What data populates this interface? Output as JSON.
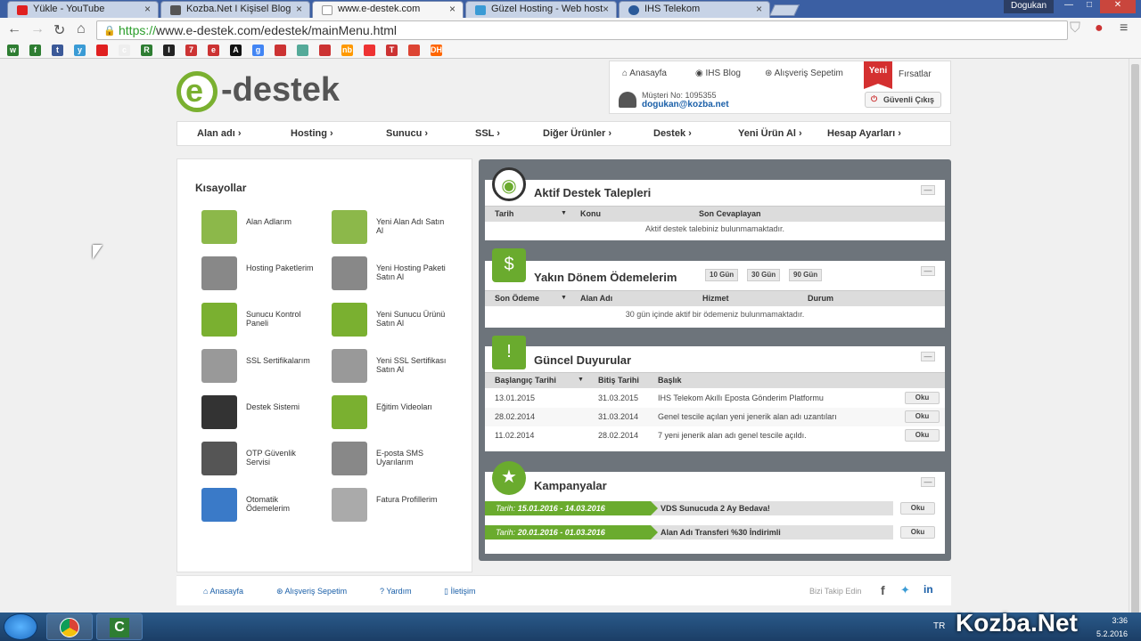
{
  "browser": {
    "tabs": [
      {
        "title": "Yükle - YouTube",
        "color": "#e02020"
      },
      {
        "title": "Kozba.Net I Kişisel Blog",
        "color": "#555555"
      },
      {
        "title": "www.e-destek.com",
        "color": "#ffffff"
      },
      {
        "title": "Güzel Hosting - Web host",
        "color": "#3a9bd5"
      },
      {
        "title": "IHS Telekom",
        "color": "#2a5a9a"
      }
    ],
    "user": "Dogukan",
    "url_scheme": "https://",
    "url_rest": "www.e-destek.com/edestek/mainMenu.html"
  },
  "bookmark_icons": [
    "w",
    "f",
    "t",
    "y",
    "",
    "c",
    "R",
    "I",
    "7",
    "e",
    "A",
    "g",
    "",
    "",
    "",
    "nb",
    "",
    "T",
    "",
    "DH"
  ],
  "logo": {
    "e": "e",
    "word": "-destek"
  },
  "header": {
    "links": [
      "Anasayfa",
      "IHS Blog",
      "Alışveriş Sepetim"
    ],
    "yeni": "Yeni",
    "firsatlar": "Fırsatlar",
    "musteri_no": "Müşteri No: 1095355",
    "email": "dogukan@kozba.net",
    "guvenli_cikis": "Güvenli Çıkış"
  },
  "menu": [
    "Alan adı",
    "Hosting",
    "Sunucu",
    "SSL",
    "Diğer Ürünler",
    "Destek",
    "Yeni Ürün Al",
    "Hesap Ayarları"
  ],
  "shortcuts": {
    "title": "Kısayollar",
    "items": [
      {
        "label": "Alan Adlarım",
        "icon": "domain-icon"
      },
      {
        "label": "Yeni Alan Adı Satın Al",
        "icon": "domain-buy-icon"
      },
      {
        "label": "Hosting Paketlerim",
        "icon": "server-icon"
      },
      {
        "label": "Yeni Hosting Paketi Satın Al",
        "icon": "server-buy-icon"
      },
      {
        "label": "Sunucu Kontrol Paneli",
        "icon": "cubes-icon"
      },
      {
        "label": "Yeni Sunucu Ürünü Satın Al",
        "icon": "cubes-buy-icon"
      },
      {
        "label": "SSL Sertifikalarım",
        "icon": "ssl-icon"
      },
      {
        "label": "Yeni SSL Sertifikası Satın Al",
        "icon": "ssl-buy-icon"
      },
      {
        "label": "Destek Sistemi",
        "icon": "headset-icon"
      },
      {
        "label": "Eğitim Videoları",
        "icon": "video-icon"
      },
      {
        "label": "OTP Güvenlik Servisi",
        "icon": "otp-icon"
      },
      {
        "label": "E-posta SMS Uyarılarım",
        "icon": "mail-gear-icon"
      },
      {
        "label": "Otomatik Ödemelerim",
        "icon": "visa-icon"
      },
      {
        "label": "Fatura Profillerim",
        "icon": "invoice-icon"
      }
    ]
  },
  "support": {
    "title": "Aktif Destek Talepleri",
    "cols": [
      "Tarih",
      "Konu",
      "Son Cevaplayan"
    ],
    "empty": "Aktif destek talebiniz bulunmamaktadır."
  },
  "payments": {
    "title": "Yakın Dönem Ödemelerim",
    "filters": [
      "10 Gün",
      "30 Gün",
      "90 Gün"
    ],
    "cols": [
      "Son Ödeme",
      "Alan Adı",
      "Hizmet",
      "Durum"
    ],
    "empty": "30 gün içinde aktif bir ödemeniz bulunmamaktadır."
  },
  "announcements": {
    "title": "Güncel Duyurular",
    "cols": [
      "Başlangıç Tarihi",
      "Bitiş Tarihi",
      "Başlık"
    ],
    "rows": [
      {
        "start": "13.01.2015",
        "end": "31.03.2015",
        "title": "IHS Telekom Akıllı Eposta Gönderim Platformu"
      },
      {
        "start": "28.02.2014",
        "end": "31.03.2014",
        "title": "Genel tescile açılan yeni jenerik alan adı uzantıları"
      },
      {
        "start": "11.02.2014",
        "end": "28.02.2014",
        "title": "7 yeni jenerik alan adı genel tescile açıldı."
      }
    ],
    "button": "Oku"
  },
  "campaigns": {
    "title": "Kampanyalar",
    "rows": [
      {
        "tarih_label": "Tarih:",
        "dates": "15.01.2016 - 14.03.2016",
        "title": "VDS Sunucuda 2 Ay Bedava!"
      },
      {
        "tarih_label": "Tarih:",
        "dates": "20.01.2016 - 01.03.2016",
        "title": "Alan Adı Transferi %30 İndirimli"
      }
    ],
    "button": "Oku"
  },
  "footer": {
    "links": [
      "Anasayfa",
      "Alışveriş Sepetim",
      "Yardım",
      "İletişim"
    ],
    "follow": "Bizi Takip Edin"
  },
  "taskbar": {
    "lang": "TR",
    "time": "3:36",
    "date": "5.2.2016"
  },
  "watermark": "Kozba.Net",
  "accent": "#6aab2e"
}
